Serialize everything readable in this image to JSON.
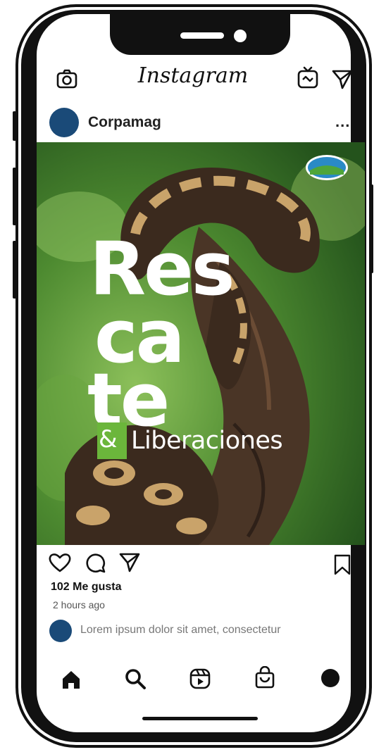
{
  "app": {
    "name": "Instagram"
  },
  "post": {
    "username": "Corpamag",
    "more_label": "...",
    "image": {
      "title_lines": [
        "Res",
        "ca",
        "te"
      ],
      "amp": "&",
      "subtitle": "Liberaciones",
      "colors": {
        "accent_green": "#6bb63b",
        "foliage": "#4f8a2f"
      }
    },
    "likes": "102 Me gusta",
    "timestamp": "2 hours ago",
    "caption": "Lorem ipsum dolor sit amet, consectetur"
  },
  "icons": {
    "top": [
      "camera-icon",
      "igtv-icon",
      "send-icon"
    ],
    "actions": [
      "heart-icon",
      "comment-icon",
      "share-icon",
      "bookmark-icon"
    ],
    "bottom_nav": [
      "home-icon",
      "search-icon",
      "reels-icon",
      "shop-icon",
      "profile-icon"
    ]
  },
  "colors": {
    "avatar": "#1a4a78",
    "frame": "#111111"
  }
}
